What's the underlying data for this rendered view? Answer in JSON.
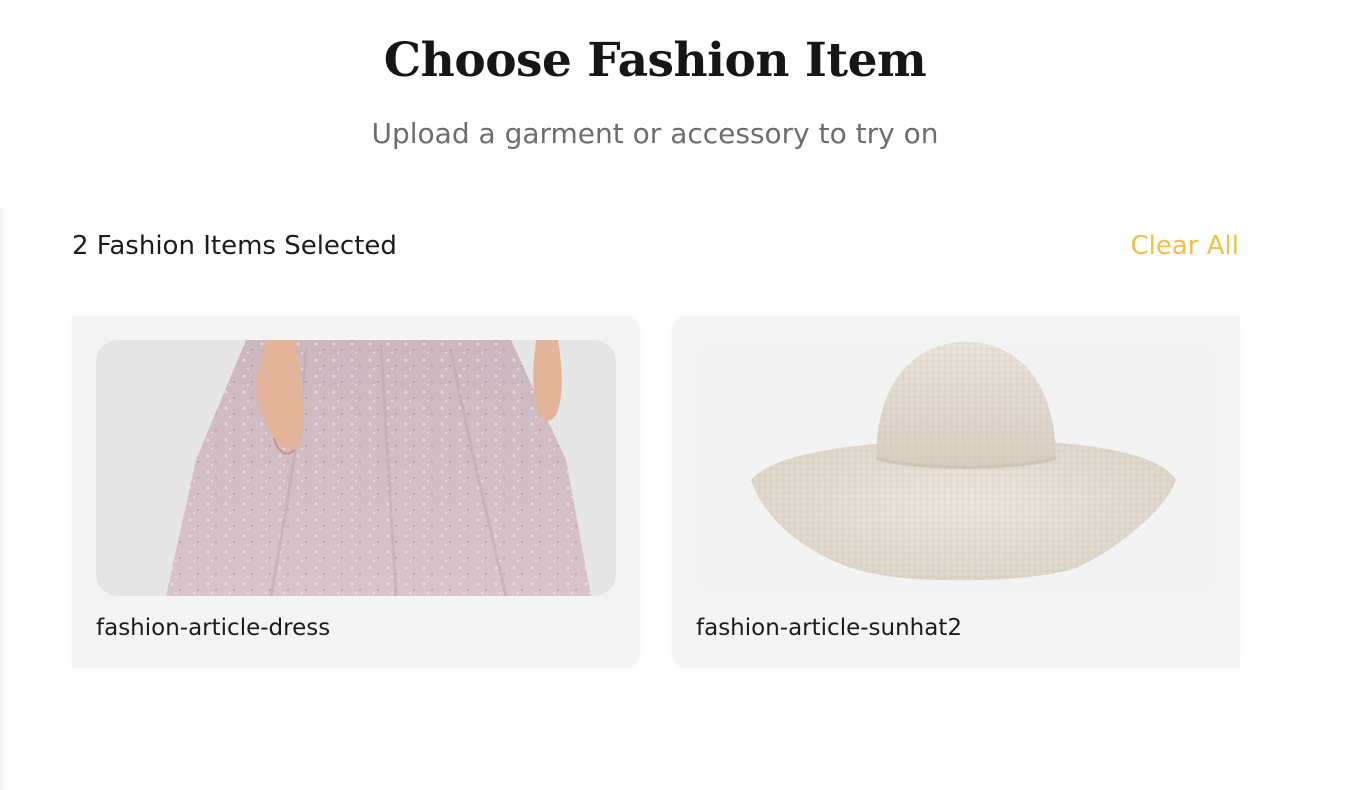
{
  "header": {
    "title": "Choose Fashion Item",
    "subtitle": "Upload a garment or accessory to try on"
  },
  "selection": {
    "count_label": "2 Fashion Items Selected",
    "clear_label": "Clear All"
  },
  "items": [
    {
      "name": "fashion-article-dress",
      "image": "dress-image"
    },
    {
      "name": "fashion-article-sunhat2",
      "image": "sunhat-image"
    }
  ],
  "colors": {
    "accent": "#f0c04a",
    "card_bg": "#f4f4f4"
  }
}
